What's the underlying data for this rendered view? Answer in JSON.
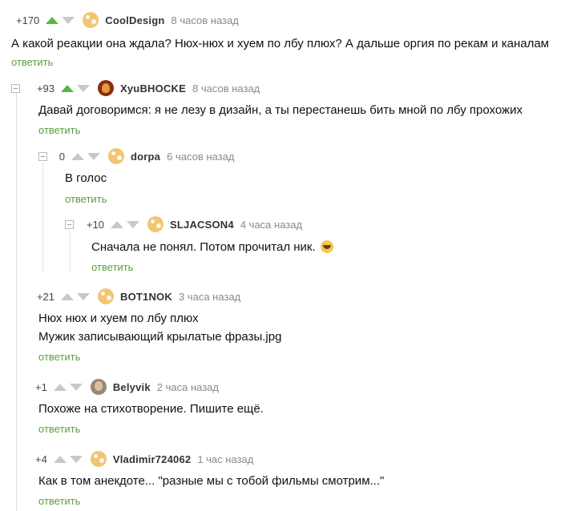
{
  "comments": [
    {
      "rating": "+170",
      "username": "CoolDesign",
      "time": "8 часов назад",
      "text": "А какой реакции она ждала? Нюх-нюх и хуем по лбу плюх? А дальше оргия по рекам и каналам",
      "reply": "ответить",
      "avatar": "default-avatar-icon"
    },
    {
      "rating": "+93",
      "username": "XyuBHOCKE",
      "time": "8 часов назад",
      "text": "Давай договоримся: я не лезу в дизайн, а ты перестанешь бить мной по лбу прохожих",
      "reply": "ответить",
      "avatar": "dark-avatar-icon"
    },
    {
      "rating": "0",
      "username": "dorpa",
      "time": "6 часов назад",
      "text": "В голос",
      "reply": "ответить",
      "avatar": "default-avatar-icon"
    },
    {
      "rating": "+10",
      "username": "SLJACSON4",
      "time": "4 часа назад",
      "text": "Сначала не понял. Потом прочитал ник.",
      "emoji": "laughing-emoji-icon",
      "reply": "ответить",
      "avatar": "default-avatar-icon"
    },
    {
      "rating": "+21",
      "username": "BOT1NOK",
      "time": "3 часа назад",
      "text_lines": [
        "Нюх нюх и хуем по лбу плюх",
        "Мужик записывающий крылатые фразы.jpg"
      ],
      "reply": "ответить",
      "avatar": "default-avatar-icon"
    },
    {
      "rating": "+1",
      "username": "Belyvik",
      "time": "2 часа назад",
      "text": "Похоже на стихотворение. Пишите ещё.",
      "reply": "ответить",
      "avatar": "photo-avatar-icon"
    },
    {
      "rating": "+4",
      "username": "Vladimir724062",
      "time": "1 час назад",
      "text": "Как в том анекдоте... \"разные мы с тобой фильмы смотрим...\"",
      "reply": "ответить",
      "avatar": "default-avatar-icon"
    }
  ],
  "colors": {
    "upvote_active": "#57b846",
    "vote_inactive": "#c8c8c8",
    "reply_link": "#5a9e3e",
    "time": "#8a8a8a"
  }
}
